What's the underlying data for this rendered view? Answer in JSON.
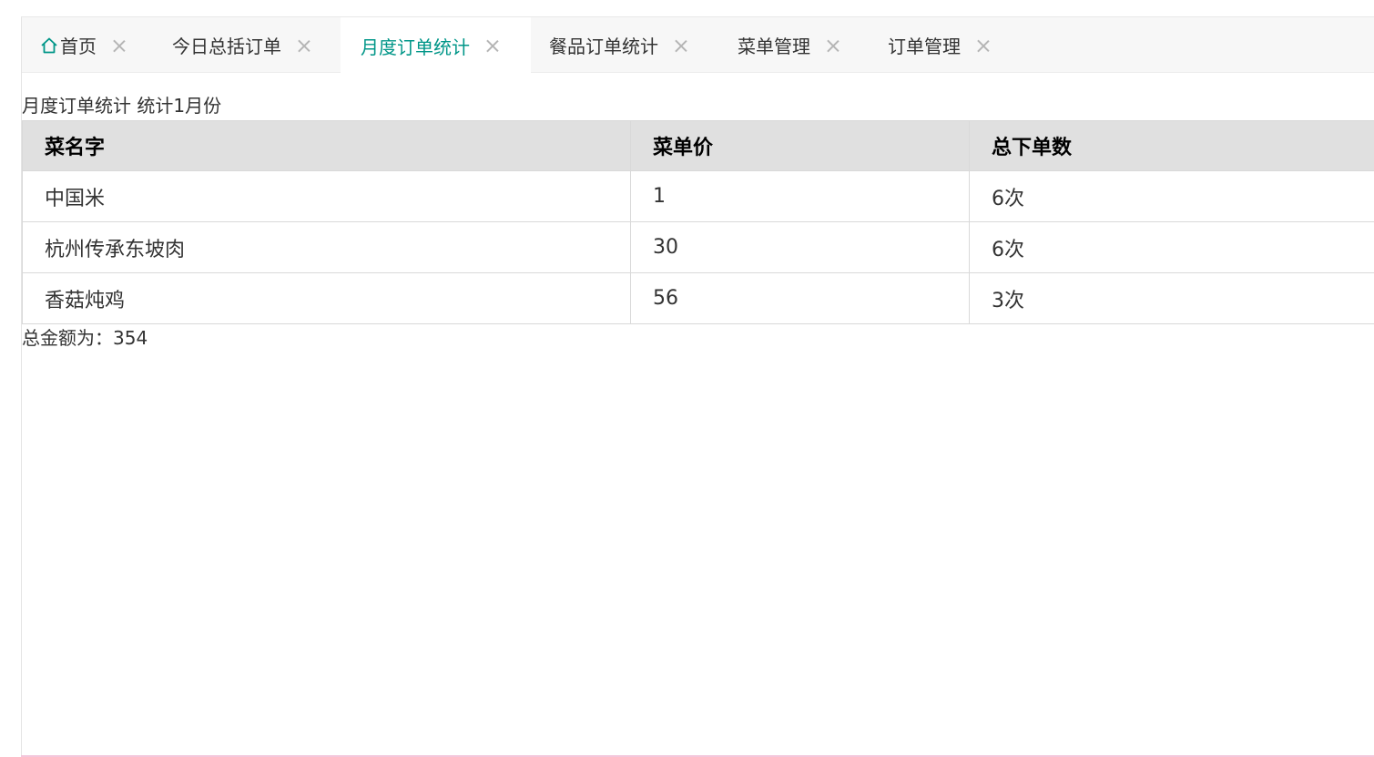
{
  "tabs": [
    {
      "label": "首页",
      "icon": "home-icon",
      "active": false
    },
    {
      "label": "今日总括订单",
      "active": false
    },
    {
      "label": "月度订单统计",
      "active": true
    },
    {
      "label": "餐品订单统计",
      "active": false
    },
    {
      "label": "菜单管理",
      "active": false
    },
    {
      "label": "订单管理",
      "active": false
    }
  ],
  "colors": {
    "accent": "#009688",
    "header_bg": "#e0e0e0"
  },
  "page": {
    "caption": "月度订单统计 统计1月份",
    "total": "总金额为：354"
  },
  "table": {
    "headers": [
      "菜名字",
      "菜单价",
      "总下单数"
    ],
    "rows": [
      [
        "中国米",
        "1",
        "6次"
      ],
      [
        "杭州传承东坡肉",
        "30",
        "6次"
      ],
      [
        "香菇炖鸡",
        "56",
        "3次"
      ]
    ]
  }
}
